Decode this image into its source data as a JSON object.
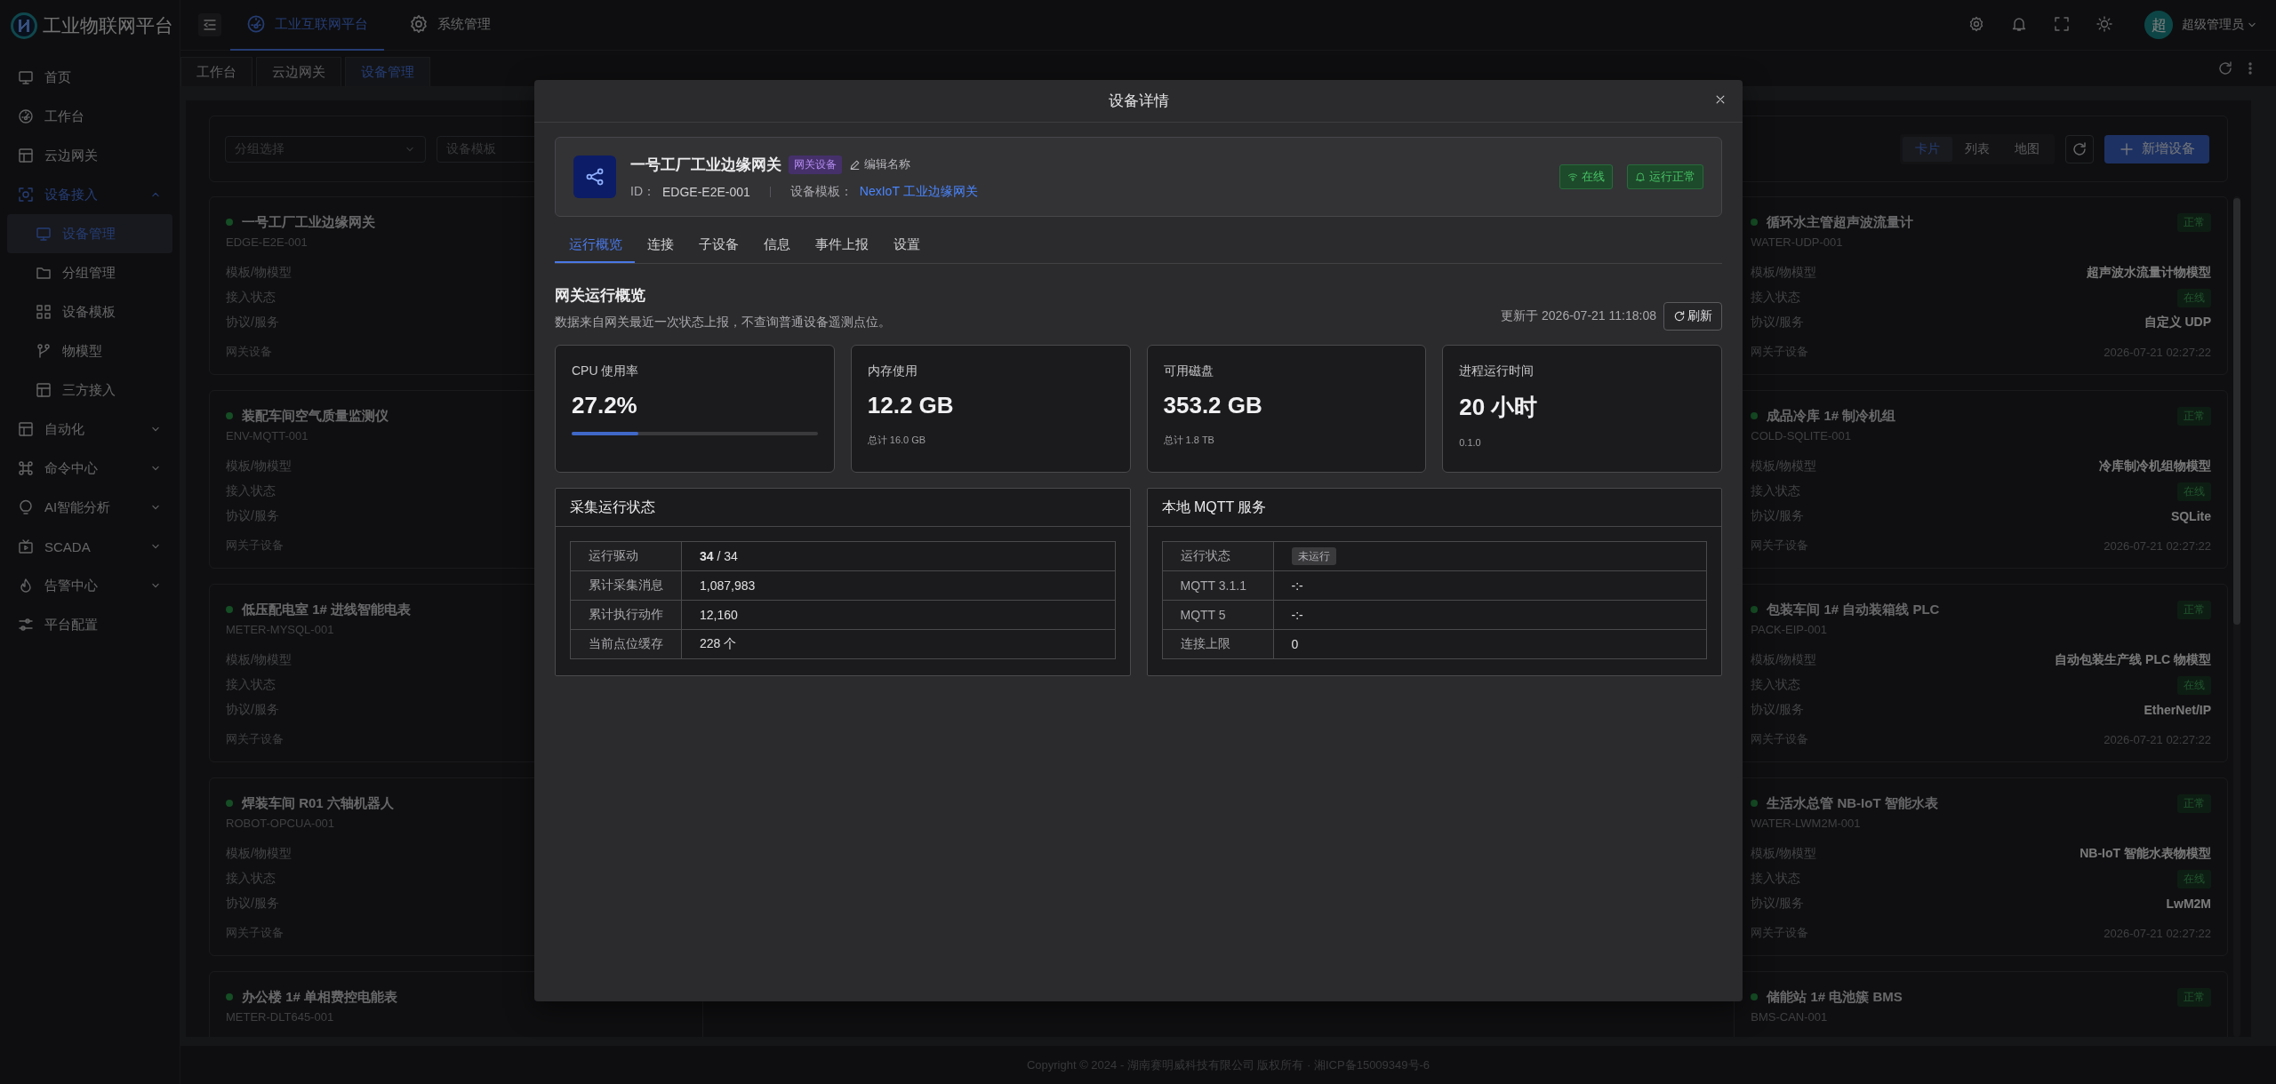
{
  "brand": {
    "title": "工业物联网平台"
  },
  "top_nav": [
    {
      "label": "工业互联网平台",
      "selected": true
    },
    {
      "label": "系统管理",
      "selected": false
    }
  ],
  "user": {
    "avatar": "超",
    "name": "超级管理员"
  },
  "sidebar": {
    "items": [
      {
        "label": "首页",
        "selected": false
      },
      {
        "label": "工作台",
        "selected": false
      },
      {
        "label": "云边网关",
        "selected": false
      },
      {
        "label": "设备接入",
        "selected": false,
        "expanded": true,
        "children": [
          {
            "label": "设备管理",
            "selected": true
          },
          {
            "label": "分组管理",
            "selected": false
          },
          {
            "label": "设备模板",
            "selected": false
          },
          {
            "label": "物模型",
            "selected": false
          },
          {
            "label": "三方接入",
            "selected": false
          }
        ]
      },
      {
        "label": "自动化",
        "selected": false,
        "expanded": false
      },
      {
        "label": "命令中心",
        "selected": false,
        "expanded": false
      },
      {
        "label": "AI智能分析",
        "selected": false,
        "expanded": false
      },
      {
        "label": "SCADA",
        "selected": false,
        "expanded": false
      },
      {
        "label": "告警中心",
        "selected": false,
        "expanded": false
      },
      {
        "label": "平台配置",
        "selected": false
      }
    ]
  },
  "page_tabs": [
    {
      "label": "工作台",
      "selected": false
    },
    {
      "label": "云边网关",
      "selected": false
    },
    {
      "label": "设备管理",
      "selected": true
    }
  ],
  "filters": {
    "group_select": {
      "placeholder": "分组选择"
    },
    "template_select": {
      "placeholder": "设备模板"
    }
  },
  "view_switch": [
    {
      "label": "卡片",
      "selected": true
    },
    {
      "label": "列表",
      "selected": false
    },
    {
      "label": "地图",
      "selected": false
    }
  ],
  "add_button": "新增设备",
  "device_cards_left": [
    {
      "name": "一号工厂工业边缘网关",
      "code": "EDGE-E2E-001",
      "online": true,
      "fields": [
        {
          "label": "模板/物模型"
        },
        {
          "label": "接入状态"
        },
        {
          "label": "协议/服务"
        }
      ],
      "type": "网关设备"
    },
    {
      "name": "装配车间空气质量监测仪",
      "code": "ENV-MQTT-001",
      "online": true,
      "fields": [
        {
          "label": "模板/物模型"
        },
        {
          "label": "接入状态"
        },
        {
          "label": "协议/服务"
        }
      ],
      "type": "网关子设备"
    },
    {
      "name": "低压配电室 1# 进线智能电表",
      "code": "METER-MYSQL-001",
      "online": true,
      "fields": [
        {
          "label": "模板/物模型"
        },
        {
          "label": "接入状态"
        },
        {
          "label": "协议/服务"
        }
      ],
      "type": "网关子设备"
    },
    {
      "name": "焊装车间 R01 六轴机器人",
      "code": "ROBOT-OPCUA-001",
      "online": true,
      "fields": [
        {
          "label": "模板/物模型"
        },
        {
          "label": "接入状态"
        },
        {
          "label": "协议/服务"
        }
      ],
      "type": "网关子设备"
    },
    {
      "name": "办公楼 1# 单相费控电能表",
      "code": "METER-DLT645-001",
      "online": true
    }
  ],
  "device_cards_right": [
    {
      "name": "循环水主管超声波流量计",
      "code": "WATER-UDP-001",
      "online": true,
      "status": "正常",
      "fields": [
        {
          "label": "模板/物模型",
          "value": "超声波水流量计物模型",
          "kind": "text"
        },
        {
          "label": "接入状态",
          "value": "在线",
          "kind": "tag"
        },
        {
          "label": "协议/服务",
          "value": "自定义 UDP",
          "kind": "text"
        }
      ],
      "type": "网关子设备",
      "time": "2026-07-21 02:27:22"
    },
    {
      "name": "成品冷库 1# 制冷机组",
      "code": "COLD-SQLITE-001",
      "online": true,
      "status": "正常",
      "fields": [
        {
          "label": "模板/物模型",
          "value": "冷库制冷机组物模型",
          "kind": "text"
        },
        {
          "label": "接入状态",
          "value": "在线",
          "kind": "tag"
        },
        {
          "label": "协议/服务",
          "value": "SQLite",
          "kind": "text"
        }
      ],
      "type": "网关子设备",
      "time": "2026-07-21 02:27:22"
    },
    {
      "name": "包装车间 1# 自动装箱线 PLC",
      "code": "PACK-EIP-001",
      "online": true,
      "status": "正常",
      "fields": [
        {
          "label": "模板/物模型",
          "value": "自动包装生产线 PLC 物模型",
          "kind": "text"
        },
        {
          "label": "接入状态",
          "value": "在线",
          "kind": "tag"
        },
        {
          "label": "协议/服务",
          "value": "EtherNet/IP",
          "kind": "text"
        }
      ],
      "type": "网关子设备",
      "time": "2026-07-21 02:27:22"
    },
    {
      "name": "生活水总管 NB-IoT 智能水表",
      "code": "WATER-LWM2M-001",
      "online": true,
      "status": "正常",
      "fields": [
        {
          "label": "模板/物模型",
          "value": "NB-IoT 智能水表物模型",
          "kind": "text"
        },
        {
          "label": "接入状态",
          "value": "在线",
          "kind": "tag"
        },
        {
          "label": "协议/服务",
          "value": "LwM2M",
          "kind": "text"
        }
      ],
      "type": "网关子设备",
      "time": "2026-07-21 02:27:22"
    },
    {
      "name": "储能站 1# 电池簇 BMS",
      "code": "BMS-CAN-001",
      "online": true,
      "status": "正常"
    }
  ],
  "footer": "Copyright © 2024 - 湖南赛明威科技有限公司 版权所有 · 湘ICP备15009349号-6",
  "modal": {
    "title": "设备详情",
    "device": {
      "name": "一号工厂工业边缘网关",
      "tag": "网关设备",
      "edit_label": "编辑名称",
      "id_label": "ID：",
      "id": "EDGE-E2E-001",
      "template_label": "设备模板：",
      "template": "NexIoT 工业边缘网关",
      "badges": [
        {
          "label": "在线",
          "kind": "wifi"
        },
        {
          "label": "运行正常",
          "kind": "bell"
        }
      ]
    },
    "tabs": [
      {
        "label": "运行概览",
        "selected": true
      },
      {
        "label": "连接",
        "selected": false
      },
      {
        "label": "子设备",
        "selected": false
      },
      {
        "label": "信息",
        "selected": false
      },
      {
        "label": "事件上报",
        "selected": false
      },
      {
        "label": "设置",
        "selected": false
      }
    ],
    "section": {
      "title": "网关运行概览",
      "subtitle": "数据来自网关最近一次状态上报，不查询普通设备遥测点位。",
      "updated": "更新于 2026-07-21 11:18:08",
      "refresh": "刷新"
    },
    "stats": [
      {
        "label": "CPU 使用率",
        "value": "27.2%",
        "level": 0.272
      },
      {
        "label": "内存使用",
        "value": "12.2 GB",
        "sub": "总计 16.0 GB"
      },
      {
        "label": "可用磁盘",
        "value": "353.2 GB",
        "sub": "总计 1.8 TB"
      },
      {
        "label": "进程运行时间",
        "value": "20 小时",
        "sub": "0.1.0"
      }
    ],
    "panels": [
      {
        "title": "采集运行状态",
        "rows": [
          {
            "label": "运行驱动",
            "value": "**34** / 34",
            "kind": "text"
          },
          {
            "label": "累计采集消息",
            "value": "1,087,983",
            "kind": "text"
          },
          {
            "label": "累计执行动作",
            "value": "12,160",
            "kind": "text"
          },
          {
            "label": "当前点位缓存",
            "value": "228 个",
            "kind": "text"
          }
        ]
      },
      {
        "title": "本地 MQTT 服务",
        "rows": [
          {
            "label": "运行状态",
            "value": "未运行",
            "kind": "tag"
          },
          {
            "label": "MQTT 3.1.1",
            "value": "-:-",
            "kind": "text"
          },
          {
            "label": "MQTT 5",
            "value": "-:-",
            "kind": "text"
          },
          {
            "label": "连接上限",
            "value": "0",
            "kind": "text"
          }
        ]
      }
    ]
  }
}
